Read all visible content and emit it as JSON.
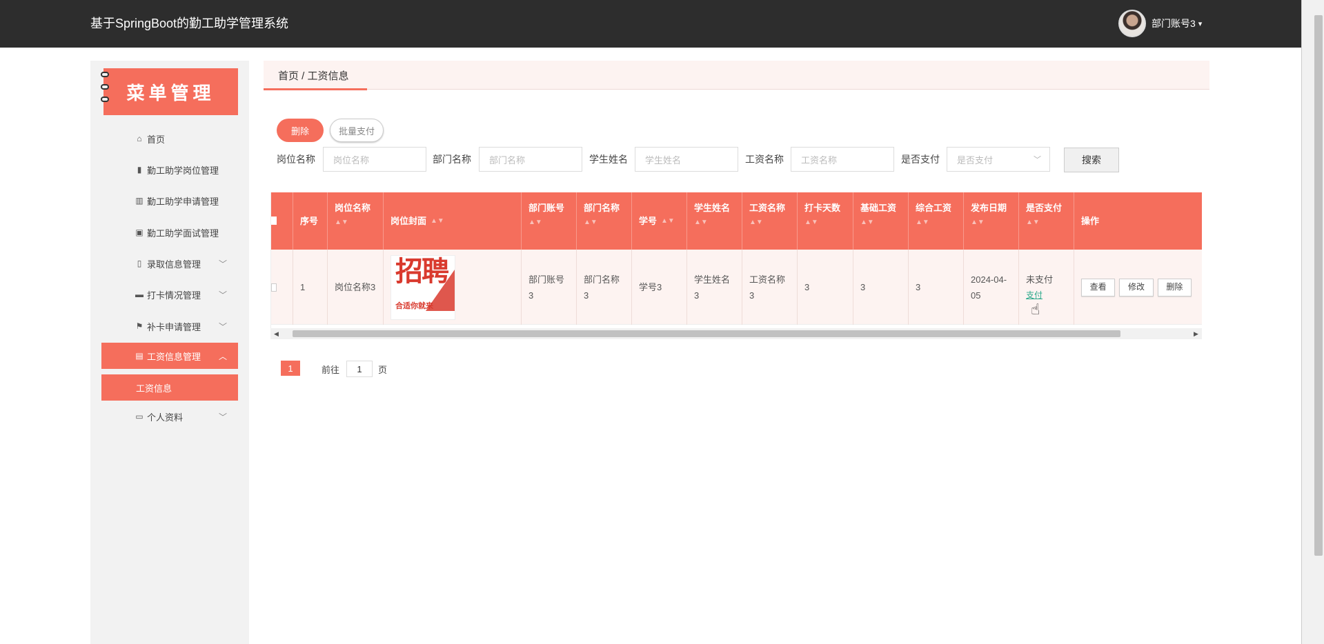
{
  "app": {
    "title": "基于SpringBoot的勤工助学管理系统"
  },
  "user": {
    "name": "部门账号3",
    "caret": "▾"
  },
  "sidebar": {
    "banner": "菜单管理",
    "items": [
      {
        "label": "首页",
        "icon": "⌂",
        "chev": ""
      },
      {
        "label": "勤工助学岗位管理",
        "icon": "▮",
        "chev": ""
      },
      {
        "label": "勤工助学申请管理",
        "icon": "▥",
        "chev": ""
      },
      {
        "label": "勤工助学面试管理",
        "icon": "▣",
        "chev": ""
      },
      {
        "label": "录取信息管理",
        "icon": "▯",
        "chev": "﹀"
      },
      {
        "label": "打卡情况管理",
        "icon": "▬",
        "chev": "﹀"
      },
      {
        "label": "补卡申请管理",
        "icon": "⚑",
        "chev": "﹀"
      },
      {
        "label": "工资信息管理",
        "icon": "▤",
        "chev": "︿"
      },
      {
        "label": "个人资料",
        "icon": "▭",
        "chev": "﹀"
      }
    ],
    "submenu_label": "工资信息"
  },
  "breadcrumb": "首页 / 工资信息",
  "toolbar": {
    "delete_label": "删除",
    "batch_pay_label": "批量支付"
  },
  "filters": {
    "post_name": {
      "label": "岗位名称",
      "placeholder": "岗位名称"
    },
    "dept_name": {
      "label": "部门名称",
      "placeholder": "部门名称"
    },
    "student_name": {
      "label": "学生姓名",
      "placeholder": "学生姓名"
    },
    "salary_name": {
      "label": "工资名称",
      "placeholder": "工资名称"
    },
    "paid": {
      "label": "是否支付",
      "placeholder": "是否支付"
    },
    "search_label": "搜索"
  },
  "table": {
    "sort_icon": "▲▼",
    "headers": {
      "index": "序号",
      "post_name": "岗位名称",
      "post_cover": "岗位封面",
      "dept_account": "部门账号",
      "dept_name": "部门名称",
      "student_no": "学号",
      "student_name": "学生姓名",
      "salary_name": "工资名称",
      "clock_days": "打卡天数",
      "base_salary": "基础工资",
      "total_salary": "综合工资",
      "publish_date": "发布日期",
      "paid": "是否支付",
      "actions": "操作"
    },
    "rows": [
      {
        "index": "1",
        "post_name": "岗位名称3",
        "poster_big": "招聘",
        "poster_sub": "合适你就来",
        "dept_account": "部门账号3",
        "dept_name": "部门名称3",
        "student_no": "学号3",
        "student_name": "学生姓名3",
        "salary_name": "工资名称3",
        "clock_days": "3",
        "base_salary": "3",
        "total_salary": "3",
        "publish_date": "2024-04-05",
        "paid_status": "未支付",
        "pay_link": "支付",
        "view_label": "查看",
        "edit_label": "修改",
        "delete_label": "删除"
      }
    ]
  },
  "pagination": {
    "current": "1",
    "goto_prefix": "前往",
    "goto_value": "1",
    "goto_suffix": "页"
  }
}
